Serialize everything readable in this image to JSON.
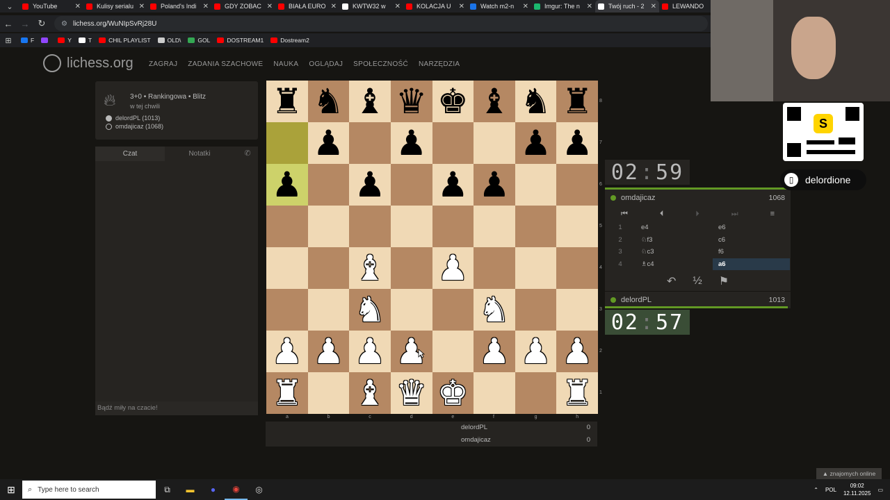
{
  "browser": {
    "tabs": [
      {
        "title": "YouTube",
        "color": "#ff0000",
        "active": false
      },
      {
        "title": "Kulisy serialu",
        "color": "#ff0000",
        "active": false
      },
      {
        "title": "Poland's Indi",
        "color": "#ff0000",
        "active": false
      },
      {
        "title": "GDY ZOBAC",
        "color": "#ff0000",
        "active": false
      },
      {
        "title": "BIAŁA EURO",
        "color": "#ff0000",
        "active": false
      },
      {
        "title": "KWTW32 w",
        "color": "#ffffff",
        "active": false
      },
      {
        "title": "KOLACJA U",
        "color": "#ff0000",
        "active": false
      },
      {
        "title": "Watch m2-n",
        "color": "#1a73e8",
        "active": false
      },
      {
        "title": "Imgur: The n",
        "color": "#1bb76e",
        "active": false
      },
      {
        "title": "Twój ruch - 2",
        "color": "#ffffff",
        "active": true
      },
      {
        "title": "LEWANDO",
        "color": "#ff0000",
        "active": false
      }
    ],
    "url": "lichess.org/WuNIpSvRj28U",
    "bookmarks": [
      {
        "label": "F",
        "color": "#1877f2"
      },
      {
        "label": "",
        "color": "#9146ff"
      },
      {
        "label": "Y",
        "color": "#ff0000"
      },
      {
        "label": "T",
        "color": "#ffffff"
      },
      {
        "label": "CHIL PLAYLIST",
        "color": "#ff0000"
      },
      {
        "label": "OLD\\",
        "color": "#cccccc"
      },
      {
        "label": "GOL",
        "color": "#34a853"
      },
      {
        "label": "DOSTREAM1",
        "color": "#ff0000"
      },
      {
        "label": "Dostream2",
        "color": "#ff0000"
      }
    ]
  },
  "lichess": {
    "logo": "lichess.org",
    "nav": [
      "ZAGRAJ",
      "ZADANIA SZACHOWE",
      "NAUKA",
      "OGLĄDAJ",
      "SPOŁECZNOŚĆ",
      "NARZĘDZIA"
    ]
  },
  "game_info": {
    "type": "3+0 • Rankingowa • Blitz",
    "when": "w tej chwili",
    "white_player": "delordPL (1013)",
    "black_player": "omdajicaz (1068)"
  },
  "chat": {
    "tab_chat": "Czat",
    "tab_notes": "Notatki",
    "placeholder": "Bądź miły na czacie!"
  },
  "board": {
    "files": [
      "a",
      "b",
      "c",
      "d",
      "e",
      "f",
      "g",
      "h"
    ],
    "ranks": [
      "8",
      "7",
      "6",
      "5",
      "4",
      "3",
      "2",
      "1"
    ],
    "rows": [
      [
        "br",
        "bn",
        "bb",
        "bq",
        "bk",
        "bb",
        "bn",
        "br"
      ],
      [
        "",
        "bp",
        "",
        "bp",
        "",
        "",
        "bp",
        "bp"
      ],
      [
        "bp",
        "",
        "bp",
        "",
        "bp",
        "bp",
        "",
        ""
      ],
      [
        "",
        "",
        "",
        "",
        "",
        "",
        "",
        ""
      ],
      [
        "",
        "",
        "wb",
        "",
        "wp",
        "",
        "",
        ""
      ],
      [
        "",
        "",
        "wn",
        "",
        "",
        "wn",
        "",
        ""
      ],
      [
        "wp",
        "wp",
        "wp",
        "wp",
        "",
        "wp",
        "wp",
        "wp"
      ],
      [
        "wr",
        "",
        "wb",
        "wq",
        "wk",
        "",
        "",
        "wr"
      ]
    ],
    "last_move": [
      "a7",
      "a6"
    ]
  },
  "crosstable": [
    {
      "name": "delordPL",
      "score": "0"
    },
    {
      "name": "omdajicaz",
      "score": "0"
    }
  ],
  "opponent": {
    "name": "omdajicaz",
    "rating": "1068",
    "clock_min": "02",
    "clock_sec": "59"
  },
  "me": {
    "name": "delordPL",
    "rating": "1013",
    "clock_min": "02",
    "clock_sec": "57"
  },
  "moves": [
    {
      "n": "1",
      "w": "e4",
      "b": "e6"
    },
    {
      "n": "2",
      "w": "♘f3",
      "b": "c6"
    },
    {
      "n": "3",
      "w": "♘c3",
      "b": "f6"
    },
    {
      "n": "4",
      "w": "♗c4",
      "b": "a6"
    }
  ],
  "controls": {
    "first": "⏮",
    "prev": "⏴",
    "next": "⏵",
    "last": "⏭",
    "menu": "≡",
    "takeback": "↶",
    "draw": "½",
    "resign": "⚑"
  },
  "stream": {
    "name": "delordione",
    "qr_logo": "S"
  },
  "online_friends": "▲ znajomych online",
  "taskbar": {
    "search_placeholder": "Type here to search",
    "lang": "POL",
    "time": "09:02",
    "date": "12.11.2025"
  }
}
